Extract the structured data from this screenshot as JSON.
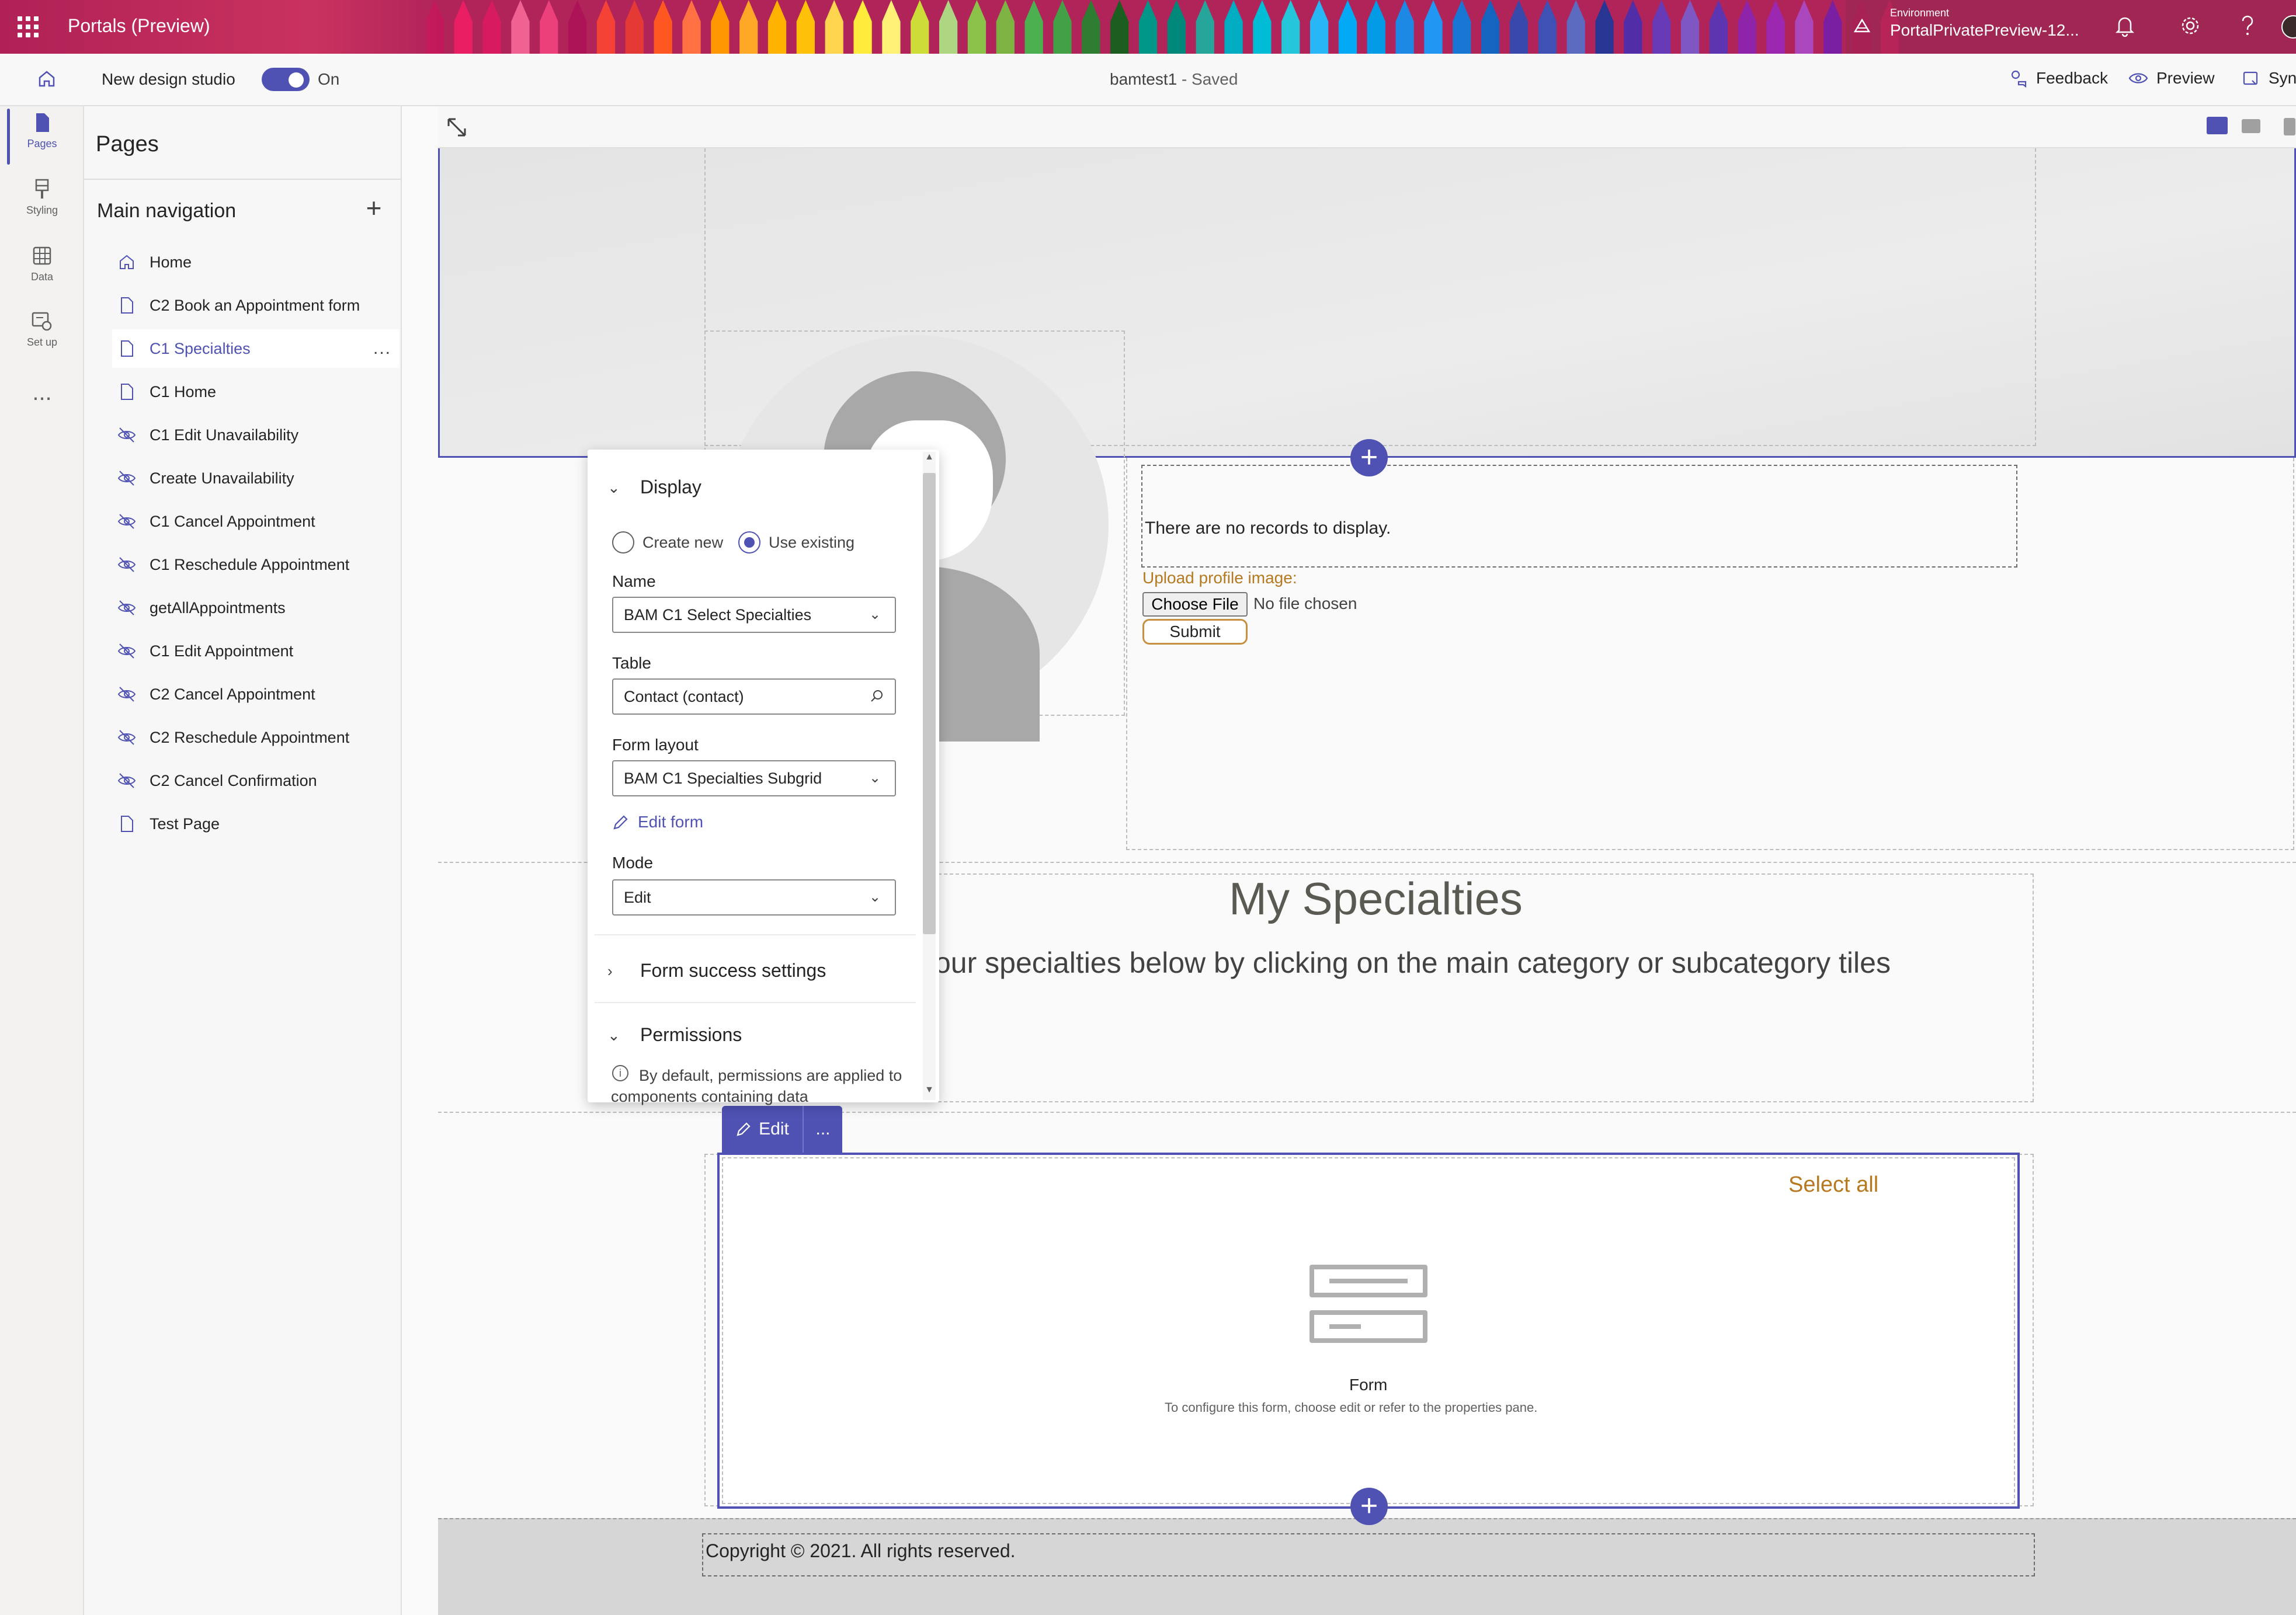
{
  "topbar": {
    "app_title": "Portals (Preview)",
    "environment_label": "Environment",
    "environment_name": "PortalPrivatePreview-12..."
  },
  "cmdbar": {
    "design_studio_label": "New design studio",
    "toggle_label": "On",
    "doc_name": "bamtest1",
    "doc_status": " - Saved",
    "feedback": "Feedback",
    "preview": "Preview",
    "sync": "Syn"
  },
  "rail": {
    "pages": "Pages",
    "styling": "Styling",
    "data": "Data",
    "setup": "Set up",
    "more": "..."
  },
  "pages_panel": {
    "title": "Pages",
    "main_nav_title": "Main navigation",
    "items": [
      {
        "label": "Home",
        "icon": "home-icon"
      },
      {
        "label": "C2 Book an Appointment form",
        "icon": "page-icon"
      },
      {
        "label": "C1 Specialties",
        "icon": "page-icon",
        "active": true
      },
      {
        "label": "C1 Home",
        "icon": "page-icon"
      },
      {
        "label": "C1 Edit Unavailability",
        "icon": "hidden-page-icon"
      },
      {
        "label": "Create Unavailability",
        "icon": "hidden-page-icon"
      },
      {
        "label": "C1 Cancel Appointment",
        "icon": "hidden-page-icon"
      },
      {
        "label": "C1 Reschedule Appointment",
        "icon": "hidden-page-icon"
      },
      {
        "label": "getAllAppointments",
        "icon": "hidden-page-icon"
      },
      {
        "label": "C1 Edit Appointment",
        "icon": "hidden-page-icon"
      },
      {
        "label": "C2 Cancel Appointment",
        "icon": "hidden-page-icon"
      },
      {
        "label": "C2 Reschedule Appointment",
        "icon": "hidden-page-icon"
      },
      {
        "label": "C2 Cancel Confirmation",
        "icon": "hidden-page-icon"
      },
      {
        "label": "Test Page",
        "icon": "page-icon"
      }
    ],
    "item_more": "..."
  },
  "canvas": {
    "no_records": "There are no records to display.",
    "upload_label": "Upload profile image:",
    "choose_file": "Choose File",
    "no_file": "No file chosen",
    "submit": "Submit",
    "specialties_title": "My Specialties",
    "specialties_subtitle": "our specialties below by clicking on the main category or subcategory tiles",
    "select_all": "Select all",
    "form_label": "Form",
    "form_hint": "To configure this form, choose edit or refer to the properties pane.",
    "edit_button": "Edit",
    "edit_more": "...",
    "copyright": "Copyright © 2021. All rights reserved.",
    "add_symbol": "+"
  },
  "flyout": {
    "display_header": "Display",
    "create_new": "Create new",
    "use_existing": "Use existing",
    "selected_option": "Use existing",
    "name_label": "Name",
    "name_value": "BAM C1 Select Specialties",
    "table_label": "Table",
    "table_value": "Contact (contact)",
    "layout_label": "Form layout",
    "layout_value": "BAM C1 Specialties Subgrid",
    "edit_form": "Edit form",
    "mode_label": "Mode",
    "mode_value": "Edit",
    "success_header": "Form success settings",
    "permissions_header": "Permissions",
    "permissions_text": "By default, permissions are applied to components containing data"
  },
  "colors": {
    "accent": "#4f52b2",
    "brand_bar": "#b0245a",
    "link_orange": "#b7791f",
    "crayons": [
      "#c2185b",
      "#e91e63",
      "#d81b60",
      "#f06292",
      "#ec407a",
      "#ad1457",
      "#f44336",
      "#e53935",
      "#ff5722",
      "#ff7043",
      "#ff9800",
      "#ffa726",
      "#ffb300",
      "#ffc107",
      "#ffd54f",
      "#ffeb3b",
      "#fff176",
      "#cddc39",
      "#aed581",
      "#8bc34a",
      "#7cb342",
      "#4caf50",
      "#43a047",
      "#2e7d32",
      "#1b5e20",
      "#009688",
      "#00897b",
      "#26a69a",
      "#00acc1",
      "#00bcd4",
      "#26c6da",
      "#29b6f6",
      "#03a9f4",
      "#039be5",
      "#1e88e5",
      "#2196f3",
      "#1976d2",
      "#1565c0",
      "#3949ab",
      "#3f51b5",
      "#5c6bc0",
      "#283593",
      "#512da8",
      "#673ab7",
      "#7e57c2",
      "#5e35b1",
      "#8e24aa",
      "#9c27b0",
      "#ab47bc",
      "#7b1fa2",
      "#c2185b",
      "#e91e63"
    ]
  }
}
